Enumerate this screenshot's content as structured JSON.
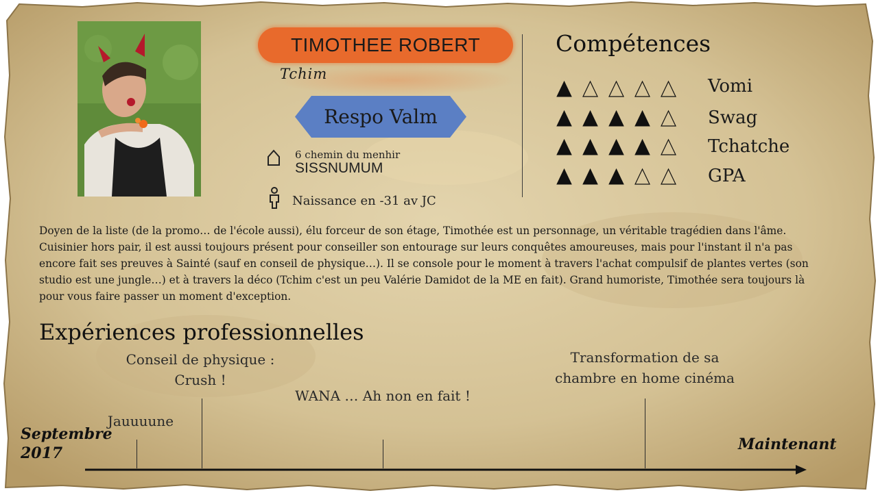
{
  "profile": {
    "name": "TIMOTHEE ROBERT",
    "nickname": "Tchim",
    "role": "Respo Valm",
    "address_line1": "6 chemin du menhir",
    "address_line2": "SISSNUMUM",
    "birth": "Naissance en -31 av JC"
  },
  "skills": {
    "title": "Compétences",
    "max": 5,
    "items": [
      {
        "label": "Vomi",
        "level": 1
      },
      {
        "label": "Swag",
        "level": 4
      },
      {
        "label": "Tchatche",
        "level": 4
      },
      {
        "label": "GPA",
        "level": 3
      }
    ]
  },
  "bio": "Doyen de la liste (de la promo… de l'école aussi), élu forceur de son étage, Timothée est un personnage, un véritable tragédien dans l'âme. Cuisinier hors pair, il est aussi toujours présent pour conseiller son entourage sur leurs conquêtes amoureuses, mais pour l'instant il n'a pas encore fait ses preuves à Sainté (sauf en conseil de physique…). Il se console pour le moment à travers l'achat compulsif de plantes vertes (son studio est une jungle…) et à travers la déco (Tchim c'est un peu Valérie Damidot de la ME en fait). Grand humoriste, Timothée sera toujours là pour vous faire passer un moment d'exception.",
  "experience": {
    "title": "Expériences professionnelles",
    "start_label": "Septembre 2017",
    "end_label": "Maintenant",
    "events": [
      {
        "text": "Jauuuune"
      },
      {
        "text": "Conseil de physique : Crush !"
      },
      {
        "text": "WANA … Ah non en fait !"
      },
      {
        "text": "Transformation de sa chambre en home cinéma"
      }
    ]
  },
  "colors": {
    "paper": "#d6c49a",
    "name_pill": "#e86a2c",
    "role_banner": "#5b7fc4"
  }
}
